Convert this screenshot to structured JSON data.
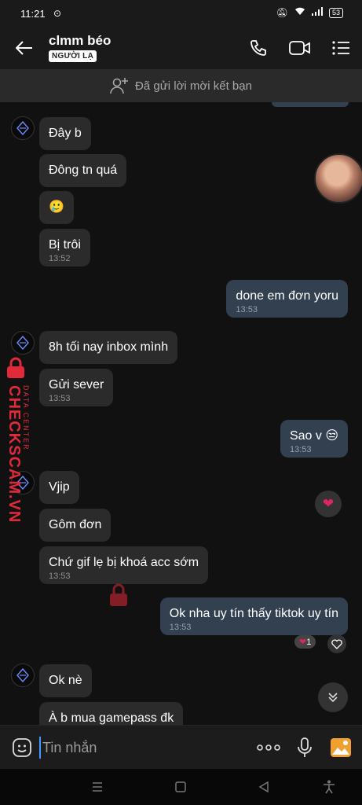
{
  "status_bar": {
    "time": "11:21",
    "battery": "53"
  },
  "header": {
    "contact_name": "clmm béo",
    "badge": "NGƯỜI LẠ"
  },
  "friend_request": {
    "text": "Đã gửi lời mời kết bạn"
  },
  "messages": [
    {
      "side": "in",
      "text": "Đây b",
      "time": ""
    },
    {
      "side": "in",
      "text": "Đông tn quá",
      "time": ""
    },
    {
      "side": "in",
      "text": "🥲",
      "time": ""
    },
    {
      "side": "in",
      "text": "Bị trôi",
      "time": "13:52"
    },
    {
      "side": "out",
      "text": "done em đơn yoru",
      "time": "13:53"
    },
    {
      "side": "in",
      "text": "8h tối nay inbox mình",
      "time": ""
    },
    {
      "side": "in",
      "text": "Gửi sever",
      "time": "13:53"
    },
    {
      "side": "out",
      "text": "Sao v 😒",
      "time": "13:53"
    },
    {
      "side": "in",
      "text": "Vjip",
      "time": ""
    },
    {
      "side": "in",
      "text": "Gôm đơn",
      "time": ""
    },
    {
      "side": "in",
      "text": "Chứ gif lẹ bị khoá acc sớm",
      "time": "13:53"
    },
    {
      "side": "out",
      "text": "Ok nha uy tín thấy tiktok uy tín",
      "time": "13:53"
    },
    {
      "side": "in",
      "text": "Ok nè",
      "time": ""
    },
    {
      "side": "in",
      "text": "À b mua gamepass đk",
      "time": ""
    }
  ],
  "reactions": {
    "heart_count": "1"
  },
  "watermark": {
    "brand": "CHECKSCAM.VN",
    "sub": "DATA CENTER"
  },
  "composer": {
    "placeholder": "Tin nhắn"
  },
  "colors": {
    "incoming_bubble": "#2b2b2b",
    "outgoing_bubble": "#324050",
    "accent": "#3f9bff",
    "watermark": "#e02a3a"
  }
}
